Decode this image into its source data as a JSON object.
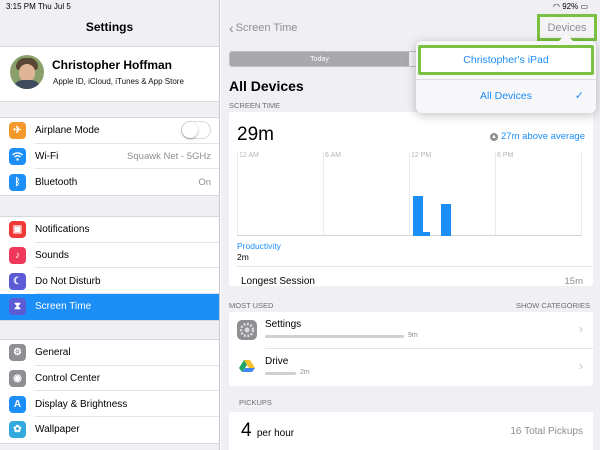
{
  "status": {
    "time_date": "3:15 PM   Thu Jul 5",
    "battery": "92%"
  },
  "left": {
    "title": "Settings",
    "profile": {
      "name": "Christopher Hoffman",
      "subtitle": "Apple ID, iCloud, iTunes & App Store"
    },
    "group1": [
      {
        "label": "Airplane Mode",
        "value": "",
        "icon": "airplane-icon",
        "color": "#f49a2c",
        "glyph": "✈",
        "toggle": false
      },
      {
        "label": "Wi-Fi",
        "value": "Squawk Net - 5GHz",
        "icon": "wifi-icon",
        "color": "#1c8ef8",
        "glyph": "◠"
      },
      {
        "label": "Bluetooth",
        "value": "On",
        "icon": "bluetooth-icon",
        "color": "#1c8ef8",
        "glyph": "ᛒ"
      }
    ],
    "group2": [
      {
        "label": "Notifications",
        "icon": "notifications-icon",
        "color": "#f03a3a",
        "glyph": "▣"
      },
      {
        "label": "Sounds",
        "icon": "sounds-icon",
        "color": "#f0385a",
        "glyph": "♪"
      },
      {
        "label": "Do Not Disturb",
        "icon": "moon-icon",
        "color": "#5b5bd6",
        "glyph": "☾"
      },
      {
        "label": "Screen Time",
        "icon": "hourglass-icon",
        "color": "#5b5bd6",
        "glyph": "⧗",
        "selected": true
      }
    ],
    "group3": [
      {
        "label": "General",
        "icon": "gear-icon",
        "color": "#8e8e93",
        "glyph": "⚙"
      },
      {
        "label": "Control Center",
        "icon": "control-center-icon",
        "color": "#8e8e93",
        "glyph": "◉"
      },
      {
        "label": "Display & Brightness",
        "icon": "display-icon",
        "color": "#1c8ef8",
        "glyph": "A"
      },
      {
        "label": "Wallpaper",
        "icon": "wallpaper-icon",
        "color": "#33aadd",
        "glyph": "✿"
      }
    ]
  },
  "right": {
    "back_label": "Screen Time",
    "devices_button": "Devices",
    "segment": [
      "Today",
      ""
    ],
    "heading": "All Devices",
    "screen_time_header": "SCREEN TIME",
    "total": "29m",
    "avg_note": "27m above average",
    "ticks": [
      "12 AM",
      "6 AM",
      "12 PM",
      "6 PM"
    ],
    "category": "Productivity",
    "category_value": "2m",
    "longest_label": "Longest Session",
    "longest_value": "15m",
    "most_used_header": "MOST USED",
    "show_categories": "SHOW CATEGORIES",
    "apps": [
      {
        "name": "Settings",
        "time": "9m",
        "fraction": 0.45,
        "icon": "settings-app-icon"
      },
      {
        "name": "Drive",
        "time": "2m",
        "fraction": 0.1,
        "icon": "drive-app-icon"
      }
    ],
    "pickups_header": "PICKUPS",
    "pickups_rate": "4",
    "pickups_unit": "per hour",
    "pickups_total": "16 Total Pickups"
  },
  "popover": {
    "items": [
      "Christopher's iPad",
      "All Devices"
    ],
    "checked": 1
  },
  "chart_data": {
    "type": "bar",
    "x": [
      "12 PM",
      "12:30 PM",
      "2 PM"
    ],
    "values": [
      0.55,
      0.05,
      0.45
    ],
    "ylim": [
      0,
      1
    ],
    "xlabel": "",
    "ylabel": "",
    "ticks": [
      "12 AM",
      "6 AM",
      "12 PM",
      "6 PM"
    ]
  }
}
